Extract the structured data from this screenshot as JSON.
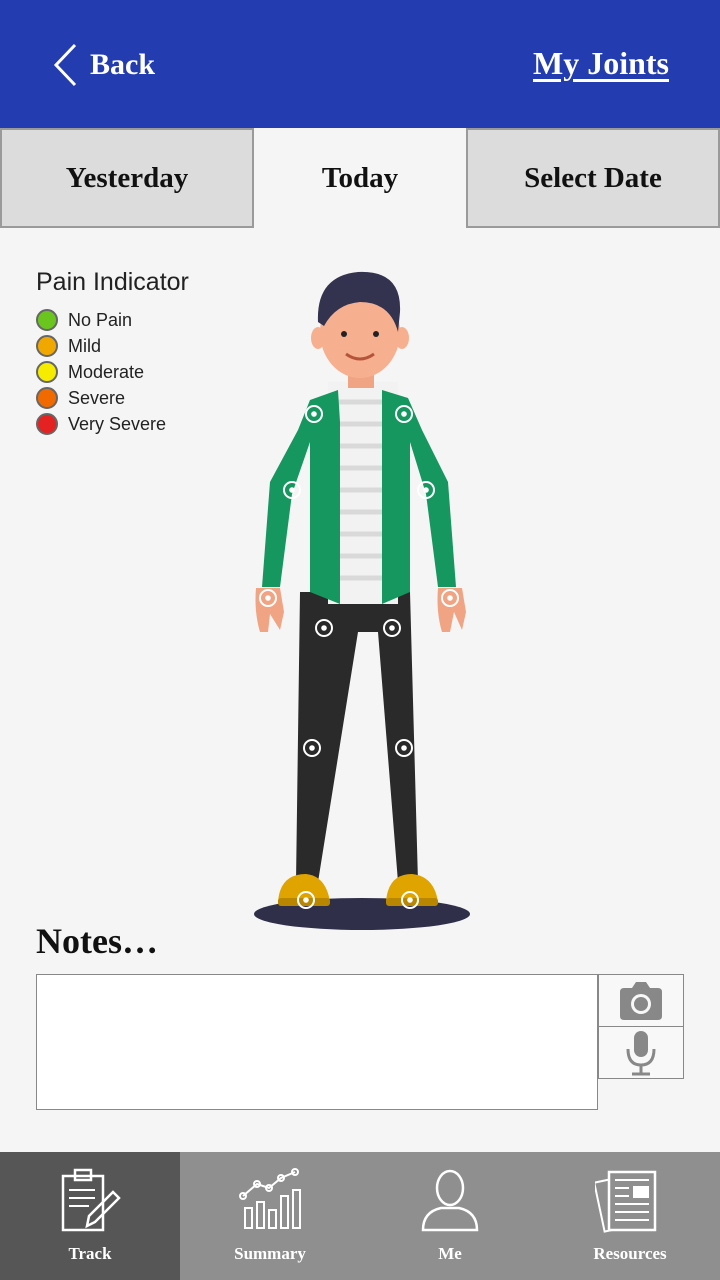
{
  "header": {
    "back_label": "Back",
    "title": "My Joints"
  },
  "tabs": [
    {
      "label": "Yesterday",
      "active": false
    },
    {
      "label": "Today",
      "active": true
    },
    {
      "label": "Select Date",
      "active": false
    }
  ],
  "legend": {
    "title": "Pain Indicator",
    "items": [
      {
        "label": "No Pain",
        "color": "#6ac61f"
      },
      {
        "label": "Mild",
        "color": "#f0a800"
      },
      {
        "label": "Moderate",
        "color": "#f5ec00"
      },
      {
        "label": "Severe",
        "color": "#f06a00"
      },
      {
        "label": "Very Severe",
        "color": "#e52222"
      }
    ]
  },
  "notes": {
    "title": "Notes…",
    "value": "",
    "camera_icon": "camera-icon",
    "mic_icon": "microphone-icon"
  },
  "nav": [
    {
      "label": "Track",
      "icon": "clipboard-pencil-icon",
      "active": true
    },
    {
      "label": "Summary",
      "icon": "chart-icon",
      "active": false
    },
    {
      "label": "Me",
      "icon": "person-icon",
      "active": false
    },
    {
      "label": "Resources",
      "icon": "newspaper-icon",
      "active": false
    }
  ]
}
